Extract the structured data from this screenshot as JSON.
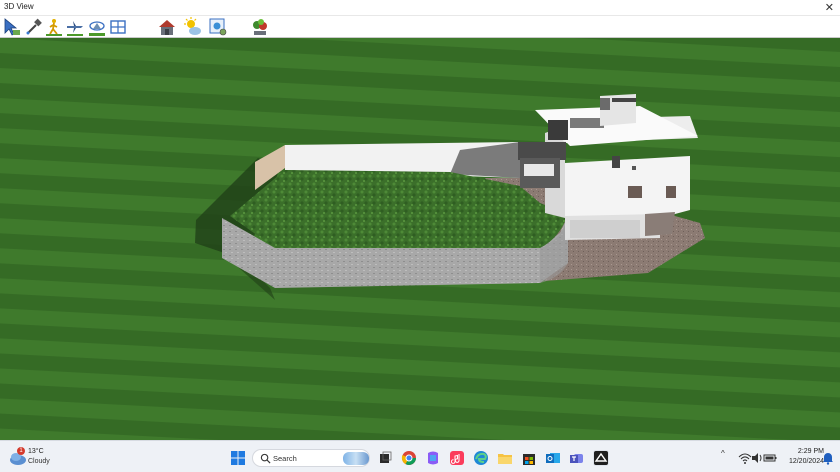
{
  "window": {
    "title": "3D View",
    "close_glyph": "✕"
  },
  "toolbar": {
    "buttons": [
      {
        "name": "select-pointer-icon"
      },
      {
        "name": "eyedropper-icon"
      },
      {
        "name": "walk-person-icon"
      },
      {
        "name": "plane-fly-icon"
      },
      {
        "name": "orbit-camera-icon"
      },
      {
        "name": "window-frame-icon"
      },
      {
        "name": "house-icon"
      },
      {
        "name": "sun-weather-icon"
      },
      {
        "name": "render-settings-icon"
      },
      {
        "name": "plants-icon"
      }
    ]
  },
  "taskbar": {
    "weather": {
      "temp": "13°C",
      "condition": "Cloudy",
      "notification_count": "1"
    },
    "search_label": "Search",
    "clock": {
      "time": "2:29 PM",
      "date": "12/20/2024"
    },
    "tray_chevron": "^"
  }
}
